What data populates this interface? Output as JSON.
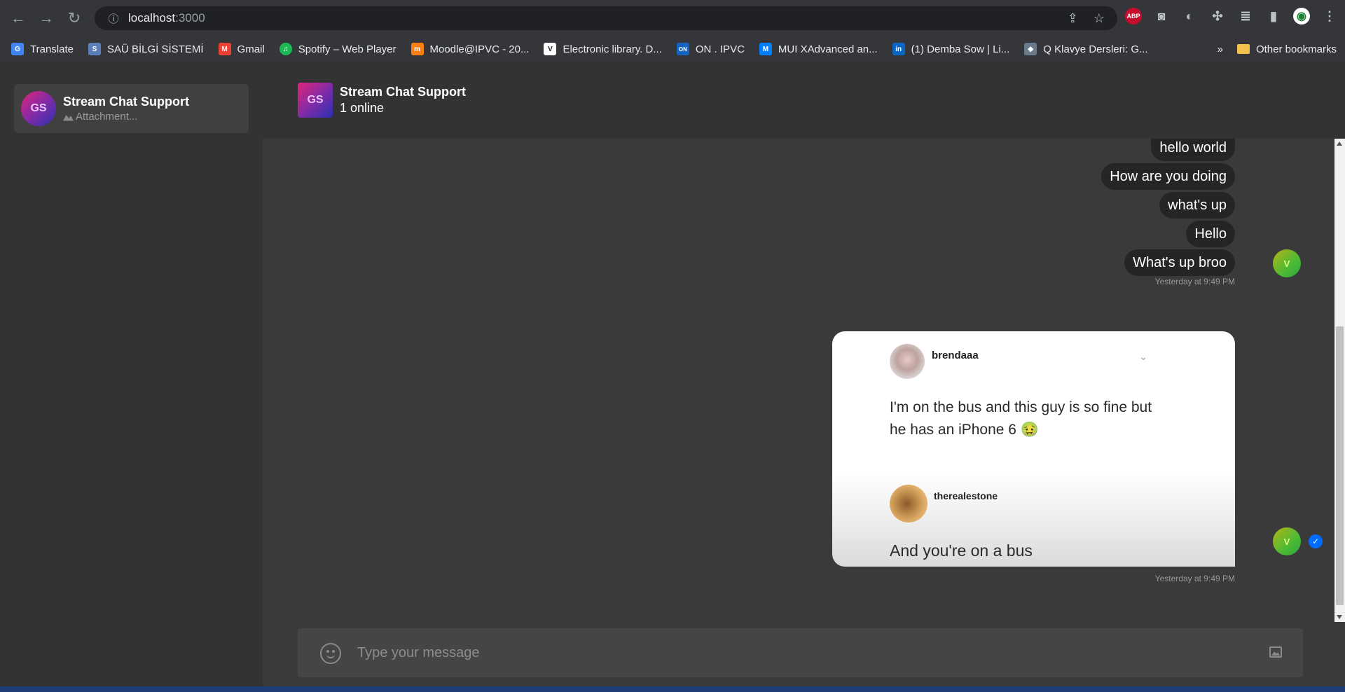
{
  "browser": {
    "url_host": "localhost",
    "url_port": ":3000",
    "bookmarks": [
      {
        "label": "Translate",
        "color": "#4285f4",
        "glyph": "G"
      },
      {
        "label": "SAÜ BİLGİ SİSTEMİ",
        "color": "#5b7fb7",
        "glyph": "S"
      },
      {
        "label": "Gmail",
        "color": "#ea4335",
        "glyph": "M"
      },
      {
        "label": "Spotify – Web Player",
        "color": "#1db954",
        "glyph": "♫"
      },
      {
        "label": "Moodle@IPVC - 20...",
        "color": "#f98012",
        "glyph": "m"
      },
      {
        "label": "Electronic library. D...",
        "color": "#ffffff",
        "glyph": "V"
      },
      {
        "label": "ON . IPVC",
        "color": "#1565c0",
        "glyph": "ON"
      },
      {
        "label": "MUI XAdvanced an...",
        "color": "#007fff",
        "glyph": "M"
      },
      {
        "label": "(1) Demba Sow | Li...",
        "color": "#0a66c2",
        "glyph": "in"
      },
      {
        "label": "Q Klavye Dersleri: G...",
        "color": "#6a7b8c",
        "glyph": "◆"
      }
    ],
    "more_bookmarks": "»",
    "other_bookmarks": "Other bookmarks",
    "ext_abp": "ABP"
  },
  "sidebar": {
    "channel_preview": {
      "avatar_initials": "GS",
      "title": "Stream Chat Support",
      "latest_message": "Attachment..."
    }
  },
  "channel_header": {
    "avatar_initials": "GS",
    "title": "Stream Chat Support",
    "subtitle": "1 online"
  },
  "messages": {
    "texts": [
      "hello world",
      "How are you doing",
      "what's up",
      "Hello",
      "What's up broo"
    ],
    "timestamp_1": "Yesterday at 9:49 PM",
    "timestamp_2": "Yesterday at 9:49 PM",
    "avatar_initial": "V",
    "image_attachment": {
      "user1": "brendaaa",
      "text1": "I'm on the bus and this guy is so fine but he has an iPhone 6 🤢",
      "user2": "therealestone",
      "text2": "And you're on a bus"
    }
  },
  "composer": {
    "placeholder": "Type your message"
  }
}
